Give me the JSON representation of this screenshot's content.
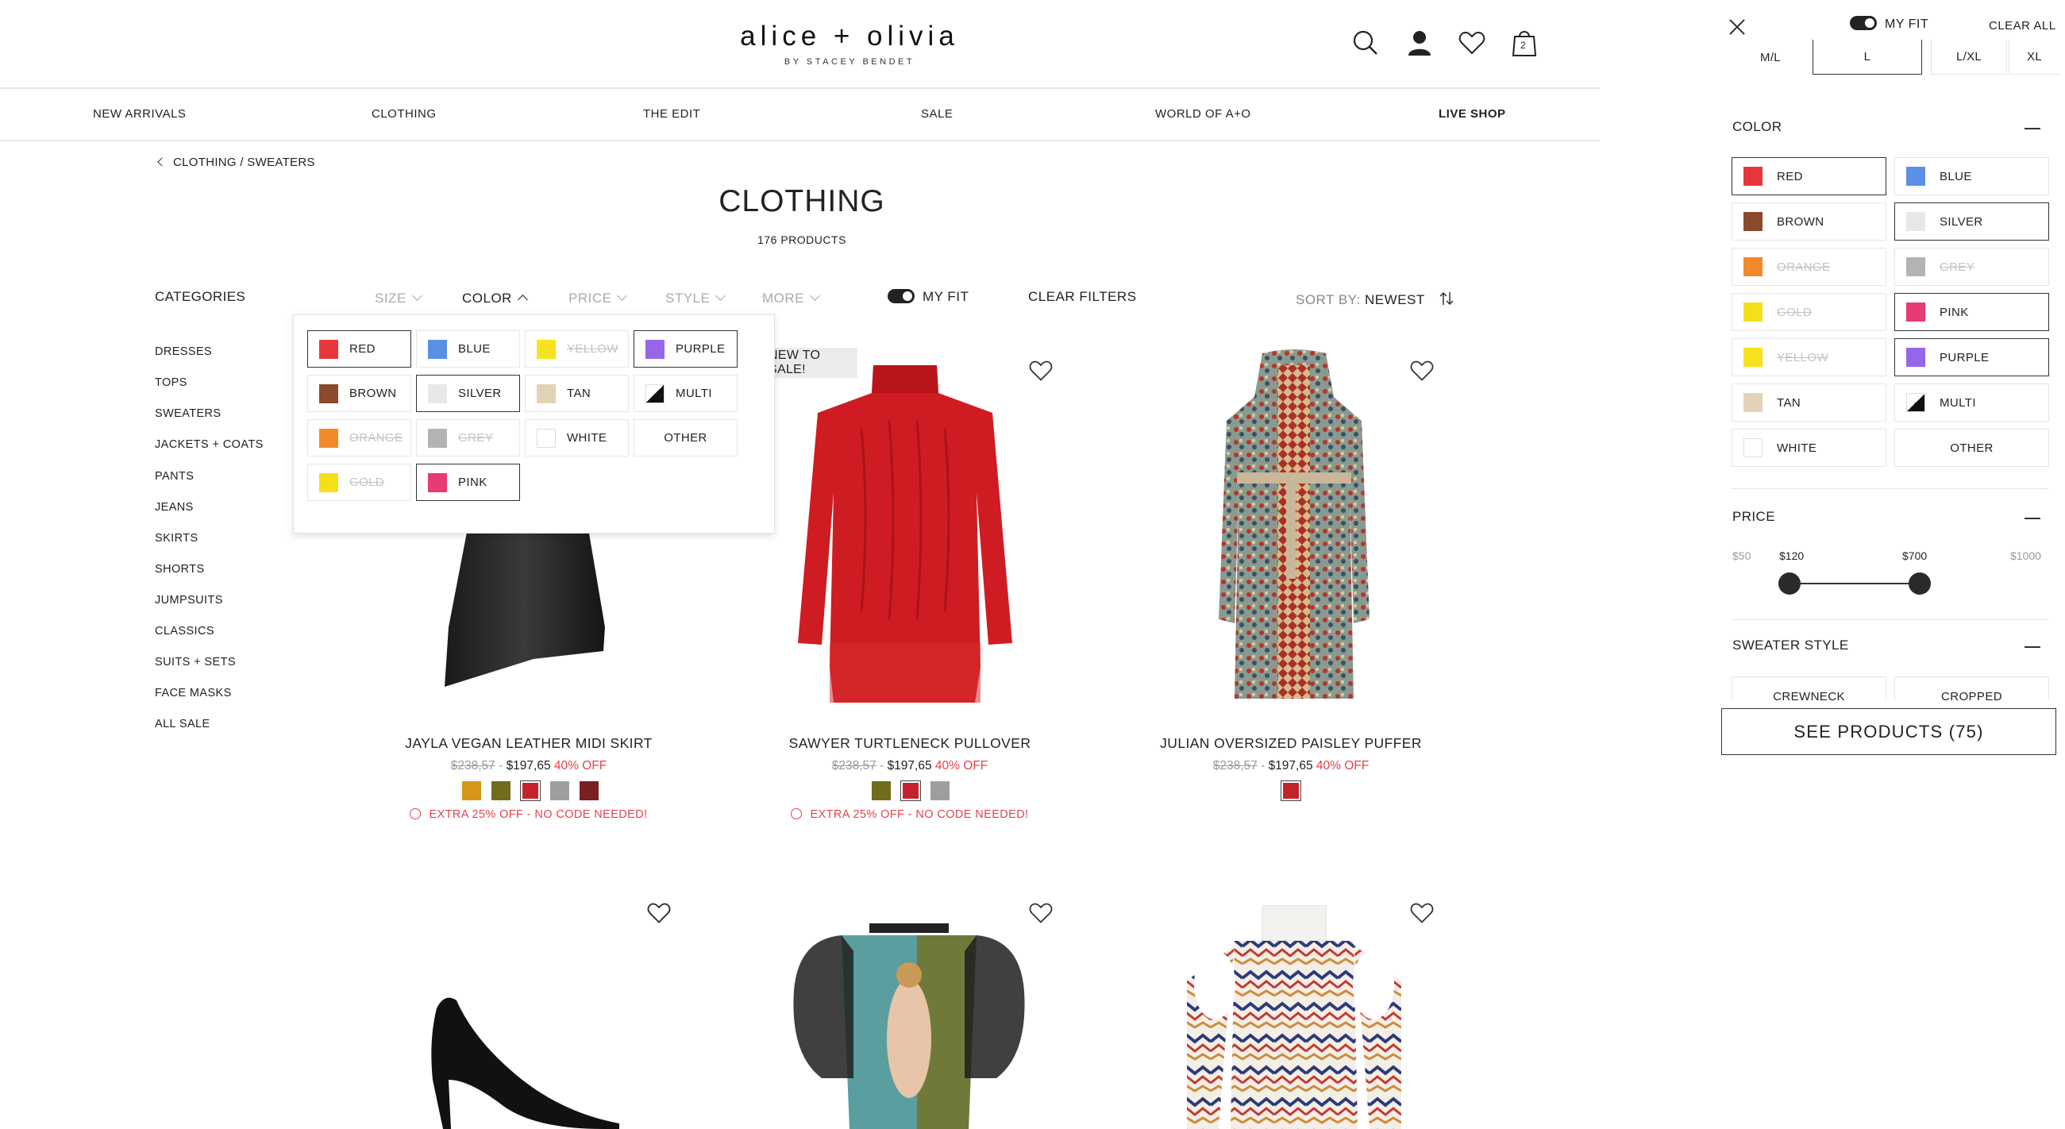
{
  "header": {
    "logo": "alice + olivia",
    "logo_sub": "BY STACEY BENDET",
    "cart_count": "2"
  },
  "nav": [
    "NEW ARRIVALS",
    "CLOTHING",
    "THE EDIT",
    "SALE",
    "WORLD OF A+O",
    "LIVE SHOP"
  ],
  "breadcrumb": "CLOTHING / SWEATERS",
  "page": {
    "title": "CLOTHING",
    "count": "176 PRODUCTS"
  },
  "categories": {
    "heading": "CATEGORIES",
    "items": [
      "DRESSES",
      "TOPS",
      "SWEATERS",
      "JACKETS + COATS",
      "PANTS",
      "JEANS",
      "SKIRTS",
      "SHORTS",
      "JUMPSUITS",
      "CLASSICS",
      "SUITS + SETS",
      "FACE MASKS",
      "ALL SALE"
    ]
  },
  "filters": {
    "size": "SIZE",
    "color": "COLOR",
    "price": "PRICE",
    "style": "STYLE",
    "more": "MORE",
    "myfit": "MY FIT",
    "clear": "CLEAR FILTERS",
    "sort_label": "SORT BY:",
    "sort_value": "NEWEST"
  },
  "dropdown_colors": [
    {
      "label": "RED",
      "hex": "#e8373c",
      "state": "selected"
    },
    {
      "label": "BLUE",
      "hex": "#5b8fe6",
      "state": "normal"
    },
    {
      "label": "YELLOW",
      "hex": "#f6e21e",
      "state": "disabled"
    },
    {
      "label": "PURPLE",
      "hex": "#9566ea",
      "state": "selected"
    },
    {
      "label": "BROWN",
      "hex": "#8a4a2b",
      "state": "normal"
    },
    {
      "label": "SILVER",
      "hex": "#e8e8e8",
      "state": "selected"
    },
    {
      "label": "TAN",
      "hex": "#e3d3b6",
      "state": "normal"
    },
    {
      "label": "MULTI",
      "hex": "multi",
      "state": "normal"
    },
    {
      "label": "ORANGE",
      "hex": "#f18a2b",
      "state": "disabled"
    },
    {
      "label": "GREY",
      "hex": "#b3b3b3",
      "state": "disabled"
    },
    {
      "label": "WHITE",
      "hex": "#ffffff",
      "state": "normal"
    },
    {
      "label": "OTHER",
      "hex": "",
      "state": "normal"
    },
    {
      "label": "GOLD",
      "hex": "#f3df1a",
      "state": "disabled"
    },
    {
      "label": "PINK",
      "hex": "#e83a75",
      "state": "selected"
    }
  ],
  "products": [
    {
      "name": "JAYLA VEGAN LEATHER MIDI SKIRT",
      "orig": "$238,57",
      "price": "$197,65",
      "off": "40% OFF",
      "swatches": [
        "#d69618",
        "#6f6d1d",
        "#c4222c",
        "#9e9e9e",
        "#7a2020"
      ],
      "selected_swatch": 2,
      "promo": "EXTRA 25% OFF - NO CODE NEEDED!"
    },
    {
      "name": "SAWYER TURTLENECK PULLOVER",
      "orig": "$238,57",
      "price": "$197,65",
      "off": "40% OFF",
      "swatches": [
        "#6f6d1d",
        "#c4222c",
        "#9e9e9e"
      ],
      "selected_swatch": 1,
      "promo": "EXTRA 25% OFF - NO CODE NEEDED!",
      "badge": "NEW TO SALE!"
    },
    {
      "name": "JULIAN OVERSIZED PAISLEY PUFFER",
      "orig": "$238,57",
      "price": "$197,65",
      "off": "40% OFF",
      "swatches": [
        "#c4222c"
      ],
      "selected_swatch": 0,
      "promo": ""
    }
  ],
  "panel": {
    "myfit": "MY FIT",
    "clear_all": "CLEAR ALL",
    "sizes": [
      "M/L",
      "L",
      "L/XL",
      "XL"
    ],
    "selected_size": "L",
    "color_heading": "COLOR",
    "colors": [
      {
        "label": "RED",
        "hex": "#e8373c",
        "state": "selected"
      },
      {
        "label": "BLUE",
        "hex": "#5b8fe6",
        "state": "normal"
      },
      {
        "label": "BROWN",
        "hex": "#8a4a2b",
        "state": "normal"
      },
      {
        "label": "SILVER",
        "hex": "#e8e8e8",
        "state": "selected"
      },
      {
        "label": "ORANGE",
        "hex": "#f18a2b",
        "state": "disabled"
      },
      {
        "label": "GREY",
        "hex": "#b3b3b3",
        "state": "disabled"
      },
      {
        "label": "GOLD",
        "hex": "#f3df1a",
        "state": "disabled"
      },
      {
        "label": "PINK",
        "hex": "#e83a75",
        "state": "selected"
      },
      {
        "label": "YELLOW",
        "hex": "#f6e21e",
        "state": "disabled"
      },
      {
        "label": "PURPLE",
        "hex": "#9566ea",
        "state": "selected"
      },
      {
        "label": "TAN",
        "hex": "#e3d3b6",
        "state": "normal"
      },
      {
        "label": "MULTI",
        "hex": "multi",
        "state": "normal"
      },
      {
        "label": "WHITE",
        "hex": "#ffffff",
        "state": "normal"
      },
      {
        "label": "OTHER",
        "hex": "",
        "state": "normal"
      }
    ],
    "price_heading": "PRICE",
    "price_min": "$50",
    "price_low": "$120",
    "price_high": "$700",
    "price_max": "$1000",
    "style_heading": "SWEATER STYLE",
    "styles": [
      "CREWNECK",
      "CROPPED"
    ],
    "see_products": "SEE PRODUCTS (75)"
  }
}
